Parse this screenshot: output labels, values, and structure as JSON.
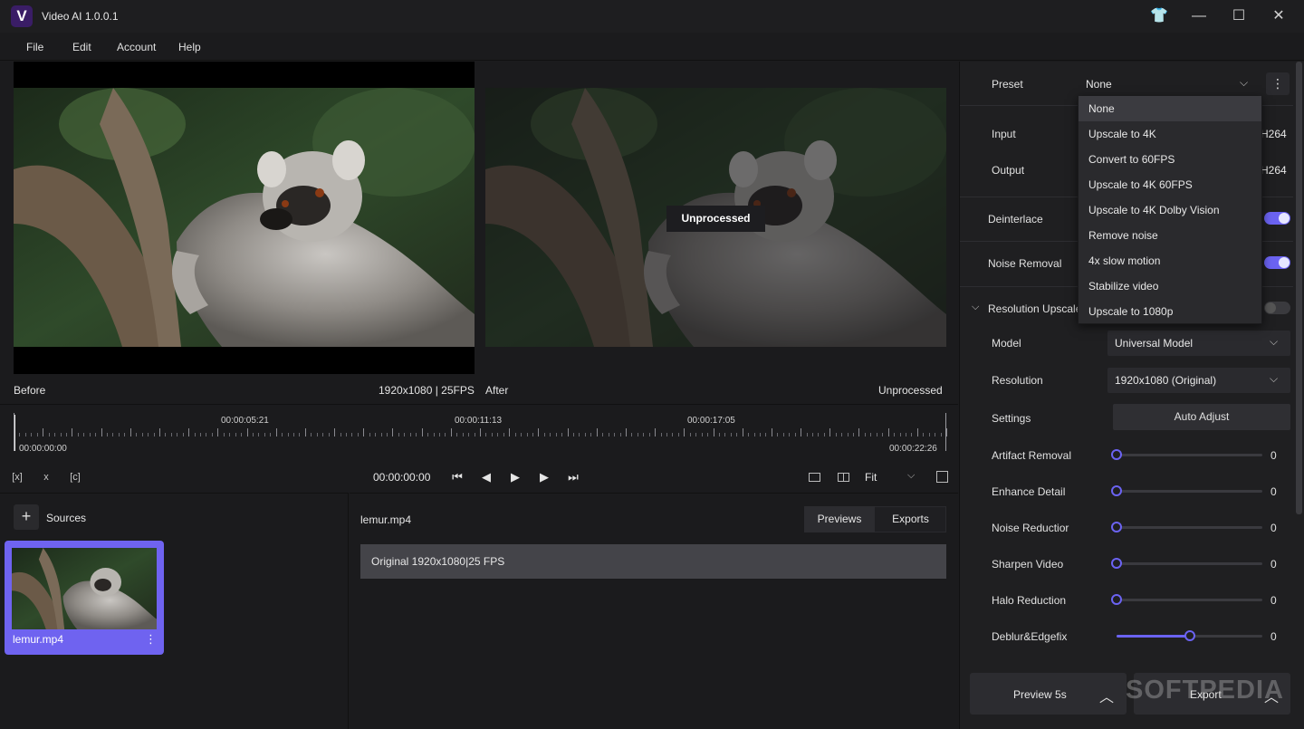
{
  "window": {
    "title": "Video AI 1.0.0.1",
    "logo_letter": "V",
    "buttons": [
      "👕",
      "—",
      "☐",
      "✕"
    ]
  },
  "menu": [
    "File",
    "Edit",
    "Account",
    "Help"
  ],
  "viewer": {
    "before_label": "Before",
    "before_info": "1920x1080 | 25FPS",
    "after_label": "After",
    "after_info": "Unprocessed",
    "after_overlay": "Unprocessed"
  },
  "timeline": {
    "start": "00:00:00:00",
    "end": "00:00:22:26",
    "markers": [
      "00:00:05:21",
      "00:00:11:13",
      "00:00:17:05"
    ]
  },
  "transport": {
    "timecode": "00:00:00:00",
    "zoom": "Fit",
    "tool_icons": [
      "[x]",
      "x",
      "[c]"
    ]
  },
  "sources": {
    "title": "Sources",
    "items": [
      {
        "name": "lemur.mp4"
      }
    ]
  },
  "files": {
    "name": "lemur.mp4",
    "tabs": [
      "Previews",
      "Exports"
    ],
    "rows": [
      "Original 1920x1080|25 FPS"
    ]
  },
  "settings": {
    "preset_label": "Preset",
    "preset_value": "None",
    "input_label": "Input",
    "input_codec": "H264",
    "output_label": "Output",
    "output_codec": "H264",
    "deinterlace_label": "Deinterlace",
    "deinterlace_on": true,
    "noise_removal_label": "Noise Removal",
    "noise_removal_on": true,
    "upscale_label": "Resolution Upscale",
    "upscale_on": false,
    "model_label": "Model",
    "model_value": "Universal Model",
    "resolution_label": "Resolution",
    "resolution_value": "1920x1080 (Original)",
    "settings_label": "Settings",
    "auto_adjust": "Auto Adjust",
    "sliders": [
      {
        "label": "Artifact Removal",
        "value": "0",
        "level": 0
      },
      {
        "label": "Enhance Detail",
        "value": "0",
        "level": 0
      },
      {
        "label": "Noise Reductior",
        "value": "0",
        "level": 0
      },
      {
        "label": "Sharpen Video",
        "value": "0",
        "level": 0
      },
      {
        "label": "Halo Reduction",
        "value": "0",
        "level": 0
      },
      {
        "label": "Deblur&Edgefix",
        "value": "0",
        "level": 0.5
      }
    ]
  },
  "preset_dropdown": [
    "None",
    "Upscale to 4K",
    "Convert to 60FPS",
    "Upscale to 4K 60FPS",
    "Upscale to 4K Dolby Vision",
    "Remove noise",
    "4x slow motion",
    "Stabilize video",
    "Upscale to 1080p"
  ],
  "actions": {
    "preview": "Preview 5s",
    "export": "Export"
  },
  "watermark": "SOFTPEDIA",
  "colors": {
    "accent": "#6b63f2",
    "background": "#1b1b1d"
  }
}
